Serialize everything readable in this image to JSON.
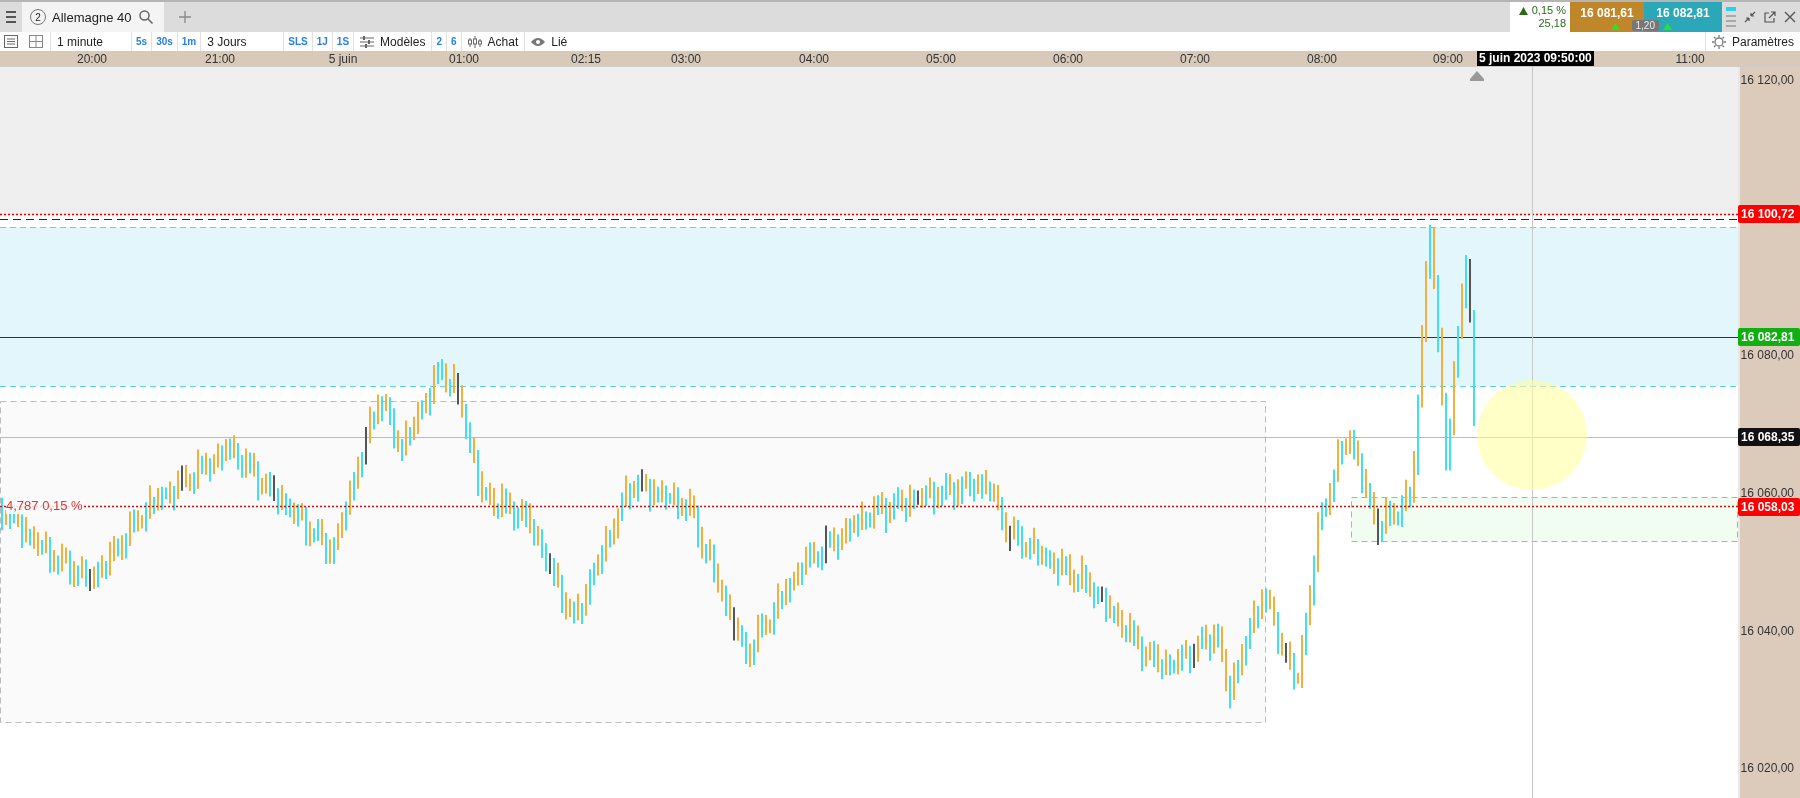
{
  "tab": {
    "number": "2",
    "title": "Allemagne 40"
  },
  "quote": {
    "change": "0,15 %",
    "change_points": "25,18",
    "bid": "16 081,61",
    "ask": "16 082,81",
    "spread": "1,20"
  },
  "toolbar": {
    "interval": "1 minute",
    "interval_buttons": [
      "5s",
      "30s",
      "1m"
    ],
    "period": "3 Jours",
    "period_buttons": [
      "SLS",
      "1J",
      "1S"
    ],
    "templates": "Modèles",
    "counts": [
      "2",
      "6"
    ],
    "order": "Achat",
    "linked": "Lié",
    "settings": "Paramètres"
  },
  "time_axis": {
    "labels": [
      "20:00",
      "21:00",
      "5 juin",
      "01:00",
      "02:15",
      "03:00",
      "04:00",
      "05:00",
      "06:00",
      "07:00",
      "08:00",
      "09:00",
      "11:00"
    ],
    "cursor_label": "5 juin 2023 09:50:00"
  },
  "price_axis": {
    "ticks": [
      "16 120,00",
      "16 080,00",
      "16 060,00",
      "16 040,00",
      "16 020,00"
    ],
    "markers": [
      {
        "value": "16 100,72",
        "color": "#ff0000"
      },
      {
        "value": "16 082,81",
        "color": "#10b010"
      },
      {
        "value": "16 068,35",
        "color": "#111111"
      },
      {
        "value": "16 058,03",
        "color": "#ff0000"
      }
    ]
  },
  "chart": {
    "line_label": "4,787 0,15 %"
  }
}
